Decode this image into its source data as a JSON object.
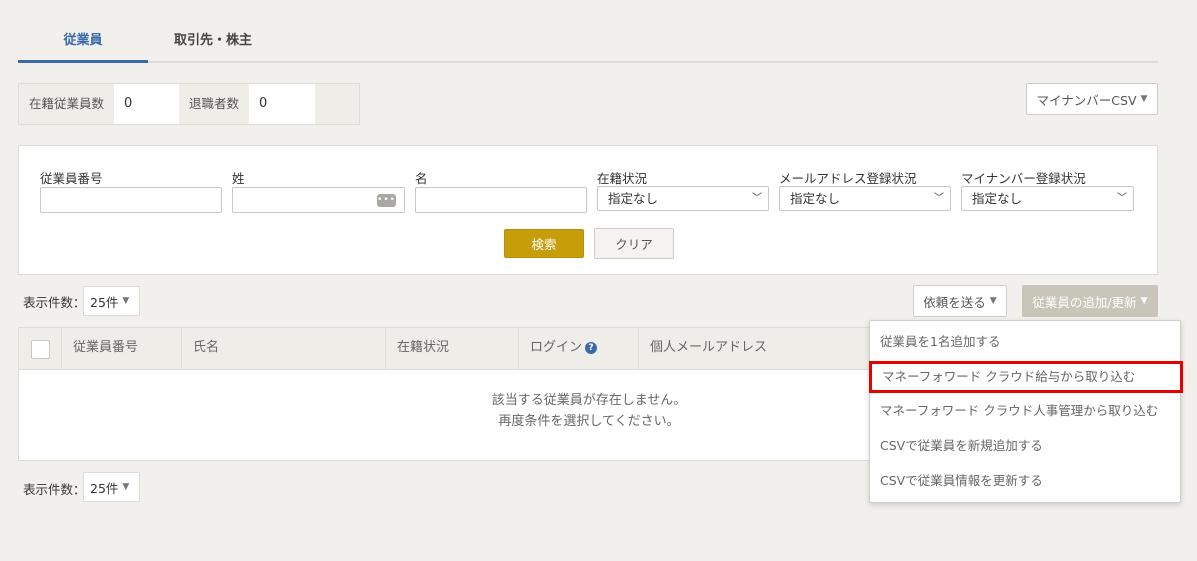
{
  "tabs": [
    {
      "label": "従業員",
      "active": true
    },
    {
      "label": "取引先・株主",
      "active": false
    }
  ],
  "counts": {
    "active_label": "在籍従業員数",
    "active_value": "0",
    "retired_label": "退職者数",
    "retired_value": "0"
  },
  "mynumber_csv_button": "マイナンバーCSV",
  "search": {
    "employee_number_label": "従業員番号",
    "last_name_label": "姓",
    "first_name_label": "名",
    "status_label": "在籍状況",
    "status_value": "指定なし",
    "email_status_label": "メールアドレス登録状況",
    "email_status_value": "指定なし",
    "mynumber_status_label": "マイナンバー登録状況",
    "mynumber_status_value": "指定なし",
    "search_button": "検索",
    "clear_button": "クリア"
  },
  "per_page": {
    "label": "表示件数：",
    "value": "25件"
  },
  "actions": {
    "request_button": "依頼を送る",
    "add_update_button": "従業員の追加/更新"
  },
  "table": {
    "columns": [
      "従業員番号",
      "氏名",
      "在籍状況",
      "ログイン",
      "個人メールアドレス"
    ],
    "empty_line1": "該当する従業員が存在しません。",
    "empty_line2": "再度条件を選択してください。"
  },
  "menu": {
    "items": [
      "従業員を1名追加する",
      "マネーフォワード クラウド給与から取り込む",
      "マネーフォワード クラウド人事管理から取り込む",
      "CSVで従業員を新規追加する",
      "CSVで従業員情報を更新する"
    ],
    "highlighted_index": 1
  },
  "colors": {
    "accent": "#3b6aa8",
    "search_button": "#c89d0a",
    "highlight_border": "#e60000",
    "background": "#f2f0ec"
  }
}
